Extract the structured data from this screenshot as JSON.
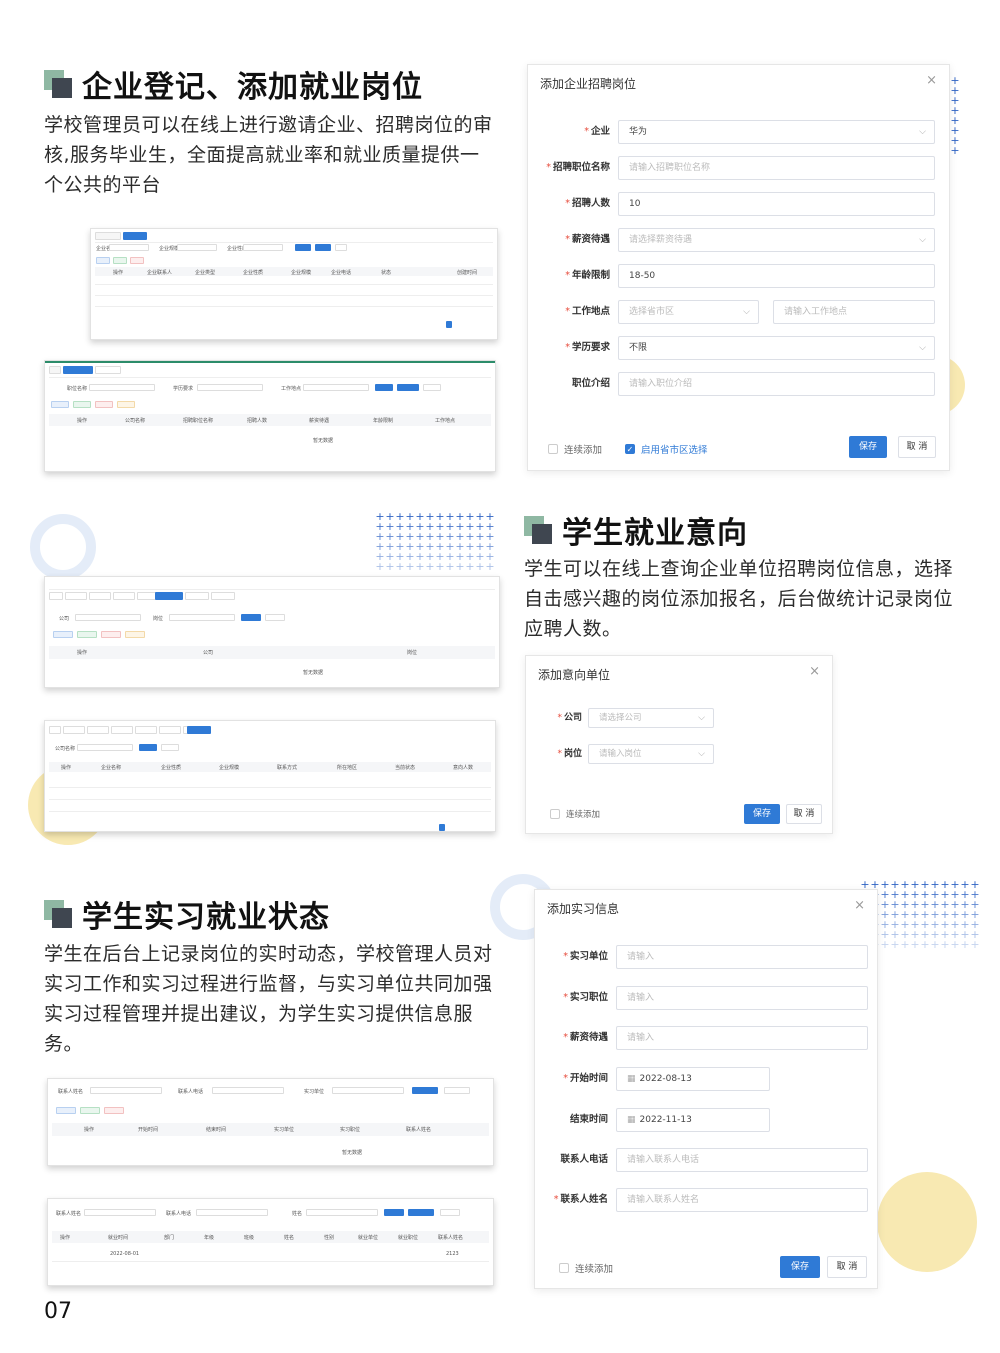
{
  "section1": {
    "title": "企业登记、添加就业岗位",
    "body": "学校管理员可以在线上进行邀请企业、招聘岗位的审核,服务毕业生，全面提高就业率和就业质量提供一个公共的平台"
  },
  "section2": {
    "title": "学生就业意向",
    "body": "学生可以在线上查询企业单位招聘岗位信息，选择自击感兴趣的岗位添加报名，后台做统计记录岗位应聘人数。"
  },
  "section3": {
    "title": "学生实习就业状态",
    "body": "学生在后台上记录岗位的实时动态，学校管理人员对实习工作和实习过程进行监督，与实习单位共同加强实习过程管理并提出建议，为学生实习提供信息服务。"
  },
  "dialog1": {
    "title": "添加企业招聘岗位",
    "close": "×",
    "fields": [
      {
        "label": "企业",
        "required": true,
        "value": "华为",
        "filled": true,
        "select": true
      },
      {
        "label": "招聘职位名称",
        "required": true,
        "value": "请输入招聘职位名称",
        "filled": false,
        "select": false
      },
      {
        "label": "招聘人数",
        "required": true,
        "value": "10",
        "filled": true,
        "select": false
      },
      {
        "label": "薪资待遇",
        "required": true,
        "value": "请选择薪资待遇",
        "filled": false,
        "select": true
      },
      {
        "label": "年龄限制",
        "required": true,
        "value": "18-50",
        "filled": true,
        "select": false
      },
      {
        "label": "工作地点",
        "required": true,
        "value": "选择省市区",
        "filled": false,
        "select": true,
        "extra": "请输入工作地点"
      },
      {
        "label": "学历要求",
        "required": true,
        "value": "不限",
        "filled": true,
        "select": true
      },
      {
        "label": "职位介绍",
        "required": false,
        "value": "请输入职位介绍",
        "filled": false,
        "select": false
      }
    ],
    "check1": "连续添加",
    "check2": "启用省市区选择",
    "save": "保存",
    "cancel": "取 消"
  },
  "dialog2": {
    "title": "添加意向单位",
    "close": "×",
    "fields": [
      {
        "label": "公司",
        "required": true,
        "value": "请选择公司"
      },
      {
        "label": "岗位",
        "required": true,
        "value": "请输入岗位"
      }
    ],
    "check1": "连续添加",
    "save": "保存",
    "cancel": "取 消"
  },
  "dialog3": {
    "title": "添加实习信息",
    "close": "×",
    "fields": [
      {
        "label": "实习单位",
        "required": true,
        "value": "请输入",
        "filled": false,
        "date": false
      },
      {
        "label": "实习职位",
        "required": true,
        "value": "请输入",
        "filled": false,
        "date": false
      },
      {
        "label": "薪资待遇",
        "required": true,
        "value": "请输入",
        "filled": false,
        "date": false
      },
      {
        "label": "开始时间",
        "required": true,
        "value": "2022-08-13",
        "filled": true,
        "date": true
      },
      {
        "label": "结束时间",
        "required": false,
        "value": "2022-11-13",
        "filled": true,
        "date": true
      },
      {
        "label": "联系人电话",
        "required": false,
        "value": "请输入联系人电话",
        "filled": false,
        "date": false
      },
      {
        "label": "联系人姓名",
        "required": true,
        "value": "请输入联系人姓名",
        "filled": false,
        "date": false
      }
    ],
    "check1": "连续添加",
    "save": "保存",
    "cancel": "取 消"
  },
  "mini1": {
    "labels": [
      "企业名称",
      "企业规模",
      "企业性质",
      "操作",
      "企业联系人",
      "企业类型",
      "企业性质",
      "企业规模",
      "企业电话",
      "状态",
      "创建时间"
    ]
  },
  "mini2": {
    "labels": [
      "职位名称",
      "学历要求",
      "工作地点",
      "操作",
      "公司名称",
      "招聘职位名称",
      "招聘人数",
      "薪资待遇",
      "年龄限制",
      "工作地点",
      "暂无数据"
    ]
  },
  "mini3": {
    "labels": [
      "公司",
      "岗位",
      "操作",
      "公司",
      "岗位",
      "暂无数据"
    ]
  },
  "mini4": {
    "labels": [
      "公司名称",
      "操作",
      "企业名称",
      "企业性质",
      "企业规模",
      "联系方式",
      "所在地区",
      "当前状态",
      "意向人数"
    ]
  },
  "mini5": {
    "labels": [
      "联系人姓名",
      "联系人电话",
      "实习单位",
      "操作",
      "开始时间",
      "结束时间",
      "实习单位",
      "实习职位",
      "联系人姓名",
      "暂无数据"
    ]
  },
  "mini6": {
    "labels": [
      "联系人姓名",
      "联系人电话",
      "姓名",
      "操作",
      "就业时间",
      "部门",
      "年级",
      "班级",
      "姓名",
      "性别",
      "就业单位",
      "就业职位",
      "联系人姓名",
      "2022-08-01",
      "2123"
    ]
  },
  "page_number": "07",
  "colors": {
    "accent_blue": "#2f7ad6",
    "icon_green": "#8fb8a3",
    "icon_dark": "#3f4650",
    "deco_yellow": "#f8e9b2"
  }
}
